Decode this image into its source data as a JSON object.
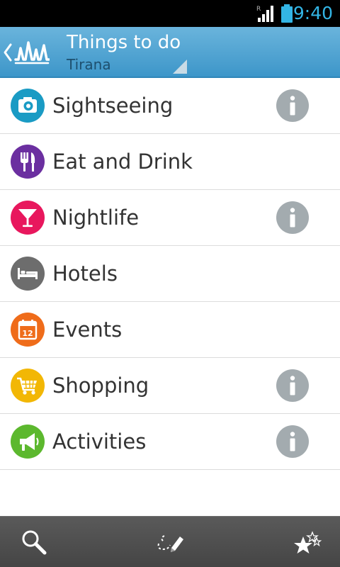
{
  "status_bar": {
    "time": "9:40",
    "roaming_indicator": "R",
    "signal_icon": "signal-icon",
    "battery_icon": "battery-icon",
    "accent_color": "#33b5e5"
  },
  "action_bar": {
    "title": "Things to do",
    "subtitle": "Tirana",
    "up_icon": "chevron-left-icon",
    "logo_icon": "skyline-logo-icon",
    "background_color": "#4ba3d4"
  },
  "categories": [
    {
      "label": "Sightseeing",
      "icon": "camera-icon",
      "color": "#1a9bc4",
      "has_info": true
    },
    {
      "label": "Eat and Drink",
      "icon": "fork-knife-icon",
      "color": "#6b2fa0",
      "has_info": false
    },
    {
      "label": "Nightlife",
      "icon": "cocktail-glass-icon",
      "color": "#e8175d",
      "has_info": true
    },
    {
      "label": "Hotels",
      "icon": "bed-icon",
      "color": "#6d6d6d",
      "has_info": false
    },
    {
      "label": "Events",
      "icon": "calendar-icon",
      "color": "#ef6c1a",
      "has_info": false,
      "icon_text": "12"
    },
    {
      "label": "Shopping",
      "icon": "shopping-cart-icon",
      "color": "#f2b705",
      "has_info": true
    },
    {
      "label": "Activities",
      "icon": "megaphone-icon",
      "color": "#5cb82e",
      "has_info": true
    }
  ],
  "info_icon": {
    "name": "info-icon",
    "color": "#a3abaf"
  },
  "bottom_bar": {
    "items": [
      {
        "icon": "search-icon"
      },
      {
        "icon": "draw-route-icon"
      },
      {
        "icon": "favorites-stars-icon"
      }
    ]
  }
}
